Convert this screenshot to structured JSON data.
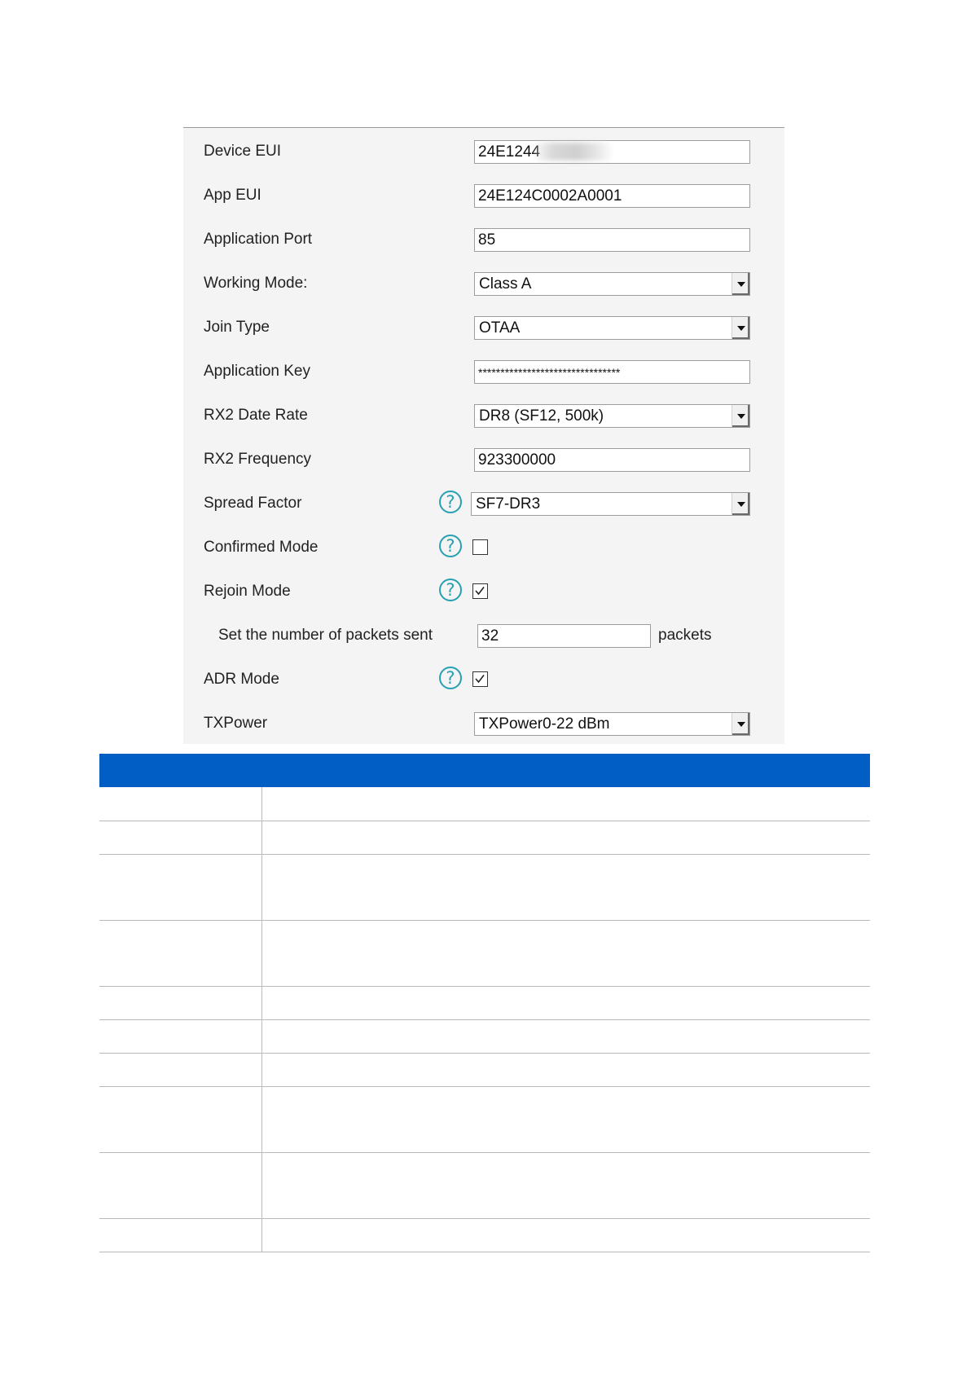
{
  "settings": {
    "device_eui": {
      "label": "Device EUI",
      "value": "24E1244"
    },
    "app_eui": {
      "label": "App EUI",
      "value": "24E124C0002A0001"
    },
    "application_port": {
      "label": "Application Port",
      "value": "85"
    },
    "working_mode": {
      "label": "Working Mode:",
      "value": "Class A"
    },
    "join_type": {
      "label": "Join Type",
      "value": "OTAA"
    },
    "application_key": {
      "label": "Application Key",
      "value": "********************************"
    },
    "rx2_data_rate": {
      "label": "RX2 Date Rate",
      "value": "DR8 (SF12, 500k)"
    },
    "rx2_frequency": {
      "label": "RX2 Frequency",
      "value": "923300000"
    },
    "spread_factor": {
      "label": "Spread Factor",
      "value": "SF7-DR3"
    },
    "confirmed_mode": {
      "label": "Confirmed Mode",
      "checked": false
    },
    "rejoin_mode": {
      "label": "Rejoin Mode",
      "checked": true
    },
    "packets_sent": {
      "label": "Set the number of packets sent",
      "value": "32",
      "unit": "packets"
    },
    "adr_mode": {
      "label": "ADR Mode",
      "checked": true
    },
    "tx_power": {
      "label": "TXPower",
      "value": "TXPower0-22 dBm"
    }
  },
  "colors": {
    "table_header": "#005ec4",
    "help_icon": "#27a0b2",
    "panel_bg": "#f4f4f4"
  }
}
